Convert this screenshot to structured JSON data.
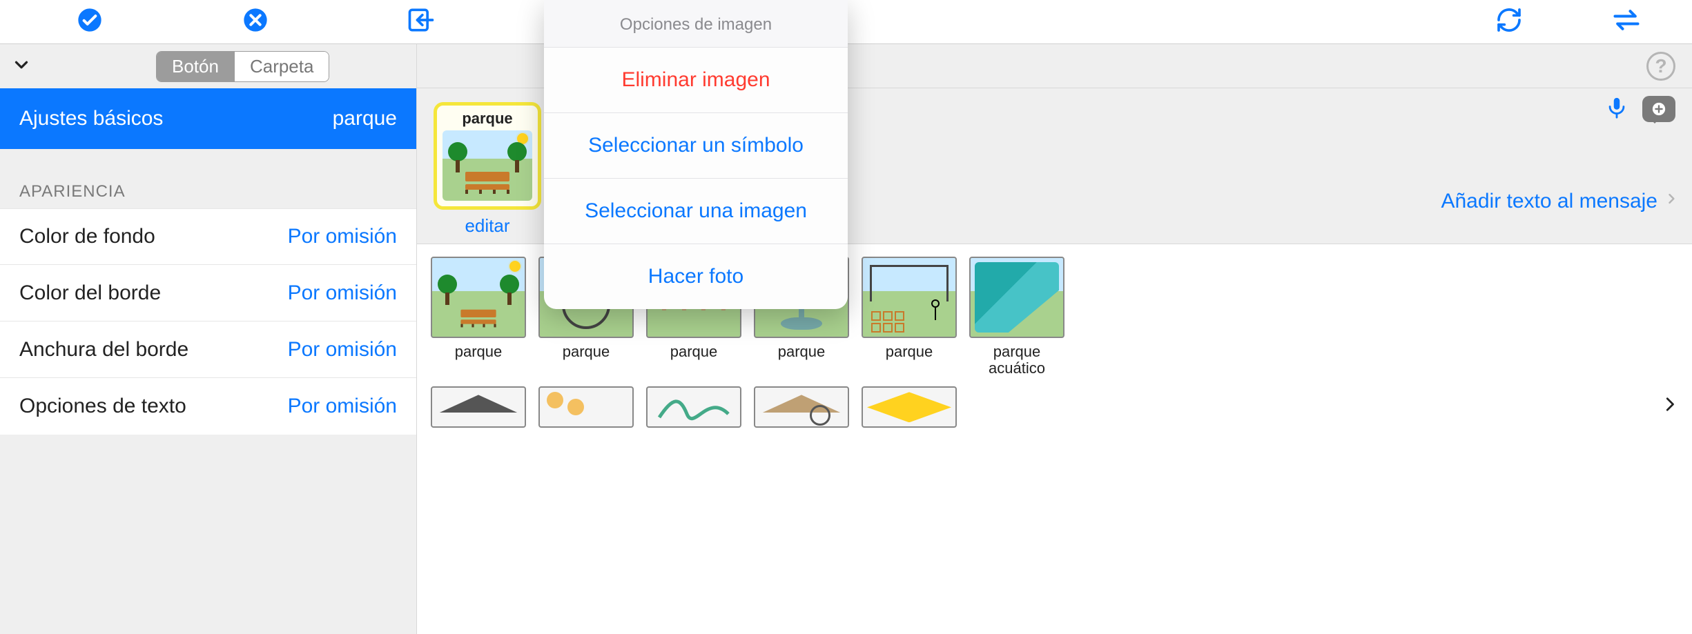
{
  "toolbar": {
    "icons": [
      "check-circle",
      "x-circle",
      "import",
      "export",
      "trash",
      "refresh",
      "swap"
    ]
  },
  "segmented": {
    "button": "Botón",
    "folder": "Carpeta",
    "active": "button"
  },
  "selected_row": {
    "title": "Ajustes básicos",
    "value": "parque"
  },
  "appearance": {
    "section": "APARIENCIA",
    "items": [
      {
        "label": "Color de fondo",
        "value": "Por omisión"
      },
      {
        "label": "Color del borde",
        "value": "Por omisión"
      },
      {
        "label": "Anchura del borde",
        "value": "Por omisión"
      },
      {
        "label": "Opciones de texto",
        "value": "Por omisión"
      }
    ]
  },
  "preview": {
    "card_label": "parque",
    "edit": "editar"
  },
  "right": {
    "add_text": "Añadir texto al mensaje"
  },
  "popover": {
    "title": "Opciones de imagen",
    "delete": "Eliminar imagen",
    "select_symbol": "Seleccionar un símbolo",
    "select_image": "Seleccionar una imagen",
    "take_photo": "Hacer foto"
  },
  "grid": {
    "row1": [
      {
        "caption": "parque",
        "variant": "park-bench"
      },
      {
        "caption": "parque",
        "variant": "trampoline"
      },
      {
        "caption": "parque",
        "variant": "pavilion"
      },
      {
        "caption": "parque",
        "variant": "fountain"
      },
      {
        "caption": "parque",
        "variant": "hopscotch"
      },
      {
        "caption": "parque acuático",
        "variant": "water-slide"
      }
    ],
    "row2_count": 5
  }
}
